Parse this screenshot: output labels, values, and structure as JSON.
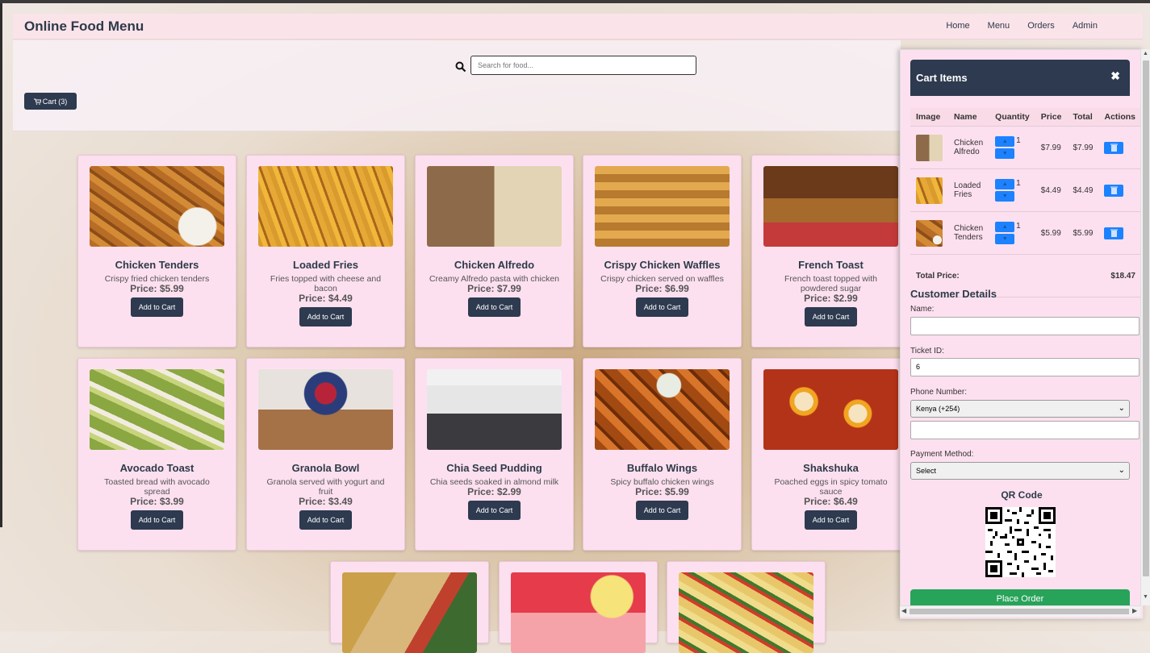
{
  "navbar": {
    "brand": "Online Food Menu",
    "links": [
      "Home",
      "Menu",
      "Orders",
      "Admin"
    ]
  },
  "search": {
    "placeholder": "Search for food..."
  },
  "cart_button": {
    "label": "Cart (3)"
  },
  "menu": [
    {
      "name": "Chicken Tenders",
      "desc": "Crispy fried chicken tenders",
      "price": "Price: $5.99",
      "btn": "Add to Cart"
    },
    {
      "name": "Loaded Fries",
      "desc": "Fries topped with cheese and bacon",
      "price": "Price: $4.49",
      "btn": "Add to Cart"
    },
    {
      "name": "Chicken Alfredo",
      "desc": "Creamy Alfredo pasta with chicken",
      "price": "Price: $7.99",
      "btn": "Add to Cart"
    },
    {
      "name": "Crispy Chicken Waffles",
      "desc": "Crispy chicken served on waffles",
      "price": "Price: $6.99",
      "btn": "Add to Cart"
    },
    {
      "name": "French Toast",
      "desc": "French toast topped with powdered sugar",
      "price": "Price: $2.99",
      "btn": "Add to Cart"
    },
    {
      "name": "Avocado Toast",
      "desc": "Toasted bread with avocado spread",
      "price": "Price: $3.99",
      "btn": "Add to Cart"
    },
    {
      "name": "Granola Bowl",
      "desc": "Granola served with yogurt and fruit",
      "price": "Price: $3.49",
      "btn": "Add to Cart"
    },
    {
      "name": "Chia Seed Pudding",
      "desc": "Chia seeds soaked in almond milk",
      "price": "Price: $2.99",
      "btn": "Add to Cart"
    },
    {
      "name": "Buffalo Wings",
      "desc": "Spicy buffalo chicken wings",
      "price": "Price: $5.99",
      "btn": "Add to Cart"
    },
    {
      "name": "Shakshuka",
      "desc": "Poached eggs in spicy tomato sauce",
      "price": "Price: $6.49",
      "btn": "Add to Cart"
    }
  ],
  "cart": {
    "title": "Cart Items",
    "columns": [
      "Image",
      "Name",
      "Quantity",
      "Price",
      "Total",
      "Actions"
    ],
    "items": [
      {
        "name": "Chicken Alfredo",
        "qty": "1",
        "price": "$7.99",
        "total": "$7.99"
      },
      {
        "name": "Loaded Fries",
        "qty": "1",
        "price": "$4.49",
        "total": "$4.49"
      },
      {
        "name": "Chicken Tenders",
        "qty": "1",
        "price": "$5.99",
        "total": "$5.99"
      }
    ],
    "total_label": "Total Price:",
    "total_value": "$18.47"
  },
  "customer": {
    "title": "Customer Details",
    "name_label": "Name:",
    "name_value": "",
    "ticket_label": "Ticket ID:",
    "ticket_value": "6",
    "phone_label": "Phone Number:",
    "phone_country": "Kenya (+254)",
    "phone_value": "",
    "payment_label": "Payment Method:",
    "payment_value": "Select"
  },
  "qr": {
    "title": "QR Code"
  },
  "place_order": "Place Order"
}
